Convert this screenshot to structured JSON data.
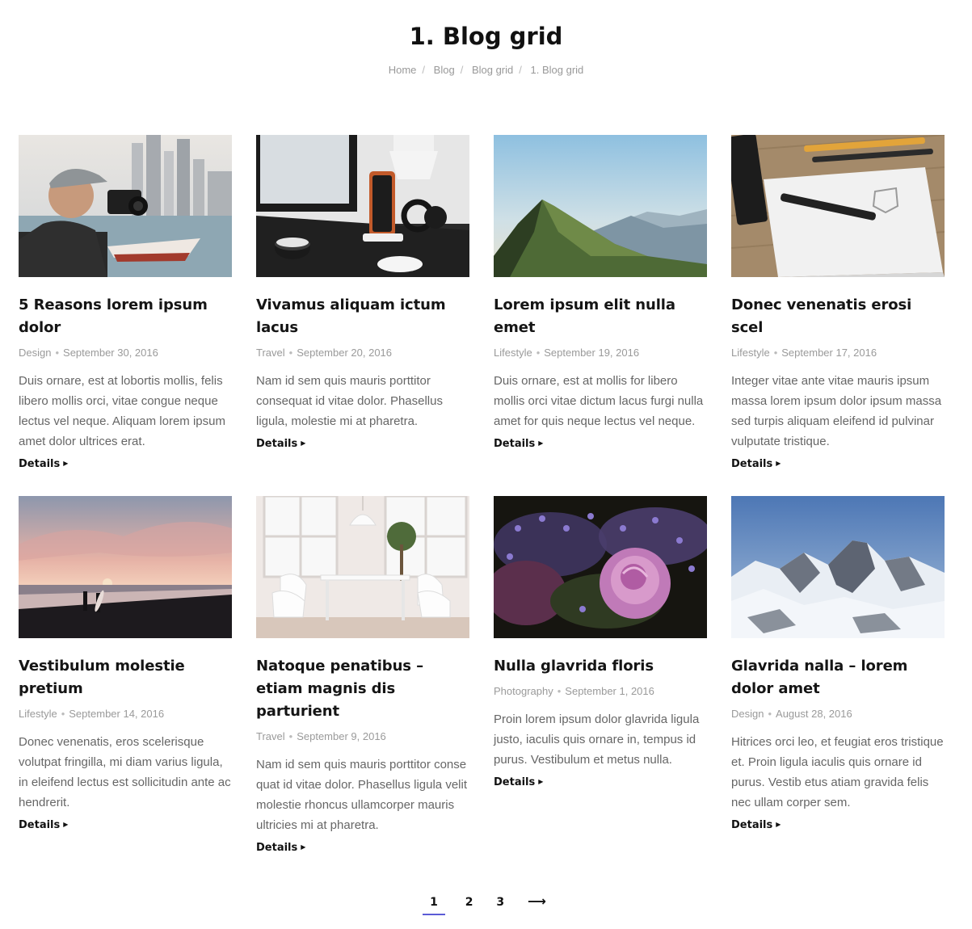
{
  "page": {
    "title": "1. Blog grid",
    "breadcrumb": [
      "Home",
      "Blog",
      "Blog grid",
      "1. Blog grid"
    ]
  },
  "posts": [
    {
      "title": "5 Reasons lorem ipsum dolor",
      "category": "Design",
      "date": "September 30, 2016",
      "excerpt": "Duis ornare, est at lobortis mollis, felis libero mollis orci, vitae congue neque lectus vel neque. Aliquam lorem ipsum amet dolor ultrices erat.",
      "details": "Details"
    },
    {
      "title": "Vivamus aliquam ictum lacus",
      "category": "Travel",
      "date": "September 20, 2016",
      "excerpt": "Nam id sem quis mauris porttitor consequat id vitae dolor. Phasellus ligula, molestie mi at pharetra.",
      "details": "Details"
    },
    {
      "title": "Lorem ipsum elit nulla emet",
      "category": "Lifestyle",
      "date": "September 19, 2016",
      "excerpt": "Duis ornare, est at mollis for libero mollis orci vitae dictum lacus furgi nulla amet for quis neque lectus vel neque.",
      "details": "Details"
    },
    {
      "title": "Donec venenatis erosi scel",
      "category": "Lifestyle",
      "date": "September 17, 2016",
      "excerpt": "Integer vitae ante vitae mauris ipsum massa lorem ipsum dolor ipsum massa sed turpis aliquam eleifend id pulvinar vulputate tristique.",
      "details": "Details"
    },
    {
      "title": "Vestibulum molestie pretium",
      "category": "Lifestyle",
      "date": "September 14, 2016",
      "excerpt": "Donec venenatis, eros scelerisque volutpat fringilla, mi diam varius ligula, in eleifend lectus est sollicitudin ante ac hendrerit.",
      "details": "Details"
    },
    {
      "title": "Natoque penatibus – etiam magnis dis parturient",
      "category": "Travel",
      "date": "September 9, 2016",
      "excerpt": "Nam id sem quis mauris porttitor conse quat id vitae dolor. Phasellus ligula velit molestie rhoncus ullamcorper mauris ultricies mi at pharetra.",
      "details": "Details"
    },
    {
      "title": "Nulla glavrida floris",
      "category": "Photography",
      "date": "September 1, 2016",
      "excerpt": "Proin lorem ipsum dolor glavrida ligula justo, iaculis quis ornare in, tempus id purus. Vestibulum et metus nulla.",
      "details": "Details"
    },
    {
      "title": "Glavrida nalla – lorem dolor amet",
      "category": "Design",
      "date": "August 28, 2016",
      "excerpt": "Hitrices orci leo, et feugiat eros tristique et. Proin ligula iaculis quis ornare id purus. Vestib etus atiam gravida felis nec ullam corper sem.",
      "details": "Details"
    }
  ],
  "pagination": {
    "pages": [
      "1",
      "2",
      "3"
    ],
    "next": "⟶",
    "current": "1"
  },
  "colors": {
    "accent": "#5b5bd6"
  }
}
